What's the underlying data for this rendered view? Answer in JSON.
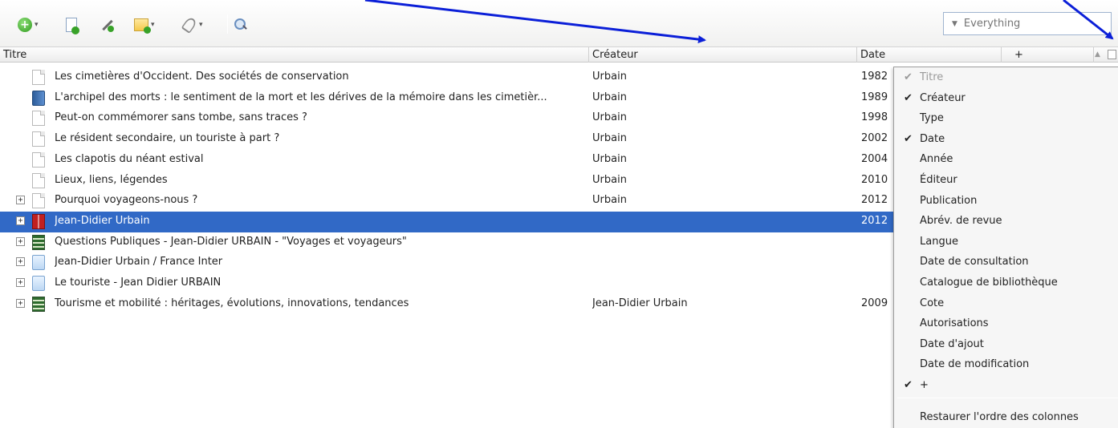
{
  "toolbar": {
    "buttons": [
      {
        "icon": "new-item-icon",
        "has_dropdown": true
      },
      {
        "icon": "add-by-identifier-icon",
        "has_dropdown": false
      },
      {
        "icon": "new-note-wand-icon",
        "has_dropdown": false
      },
      {
        "icon": "new-note-icon",
        "has_dropdown": true
      },
      {
        "icon": "attachment-paperclip-icon",
        "has_dropdown": true
      },
      {
        "icon": "advanced-search-icon",
        "has_dropdown": false
      }
    ],
    "caret": "▾",
    "search": {
      "mode_caret": "▼",
      "placeholder": "Everything"
    }
  },
  "columns": {
    "title": "Titre",
    "creator": "Créateur",
    "date": "Date",
    "extra": "+",
    "sort_indicator": "▲"
  },
  "items": [
    {
      "title": "Les cimetières d'Occident. Des sociétés de conservation",
      "creator": "Urbain",
      "date": "1982",
      "icon": "journal-article-icon",
      "expandable": false,
      "selected": false
    },
    {
      "title": "L'archipel des morts : le sentiment de la mort et les dérives de la mémoire dans les cimetièr...",
      "creator": "Urbain",
      "date": "1989",
      "icon": "book-icon",
      "expandable": false,
      "selected": false
    },
    {
      "title": "Peut-on commémorer sans tombe, sans traces ?",
      "creator": "Urbain",
      "date": "1998",
      "icon": "journal-article-icon",
      "expandable": false,
      "selected": false
    },
    {
      "title": "Le résident secondaire, un touriste à part ?",
      "creator": "Urbain",
      "date": "2002",
      "icon": "journal-article-icon",
      "expandable": false,
      "selected": false
    },
    {
      "title": "Les clapotis du néant estival",
      "creator": "Urbain",
      "date": "2004",
      "icon": "journal-article-icon",
      "expandable": false,
      "selected": false
    },
    {
      "title": "Lieux, liens, légendes",
      "creator": "Urbain",
      "date": "2010",
      "icon": "journal-article-icon",
      "expandable": false,
      "selected": false
    },
    {
      "title": "Pourquoi voyageons-nous ?",
      "creator": "Urbain",
      "date": "2012",
      "icon": "journal-article-icon",
      "expandable": true,
      "selected": false
    },
    {
      "title": "Jean-Didier Urbain",
      "creator": "",
      "date": "2012",
      "icon": "encyclopedia-icon",
      "expandable": true,
      "selected": true
    },
    {
      "title": "Questions Publiques - Jean-Didier URBAIN - \"Voyages et voyageurs\"",
      "creator": "",
      "date": "",
      "icon": "video-film-icon",
      "expandable": true,
      "selected": false
    },
    {
      "title": "Jean-Didier Urbain / France Inter",
      "creator": "",
      "date": "",
      "icon": "web-page-icon",
      "expandable": true,
      "selected": false
    },
    {
      "title": "Le touriste - Jean Didier URBAIN",
      "creator": "",
      "date": "",
      "icon": "web-page-icon",
      "expandable": true,
      "selected": false
    },
    {
      "title": "Tourisme et mobilité : héritages, évolutions, innovations, tendances",
      "creator": "Jean-Didier Urbain",
      "date": "2009",
      "icon": "video-film-icon",
      "expandable": true,
      "selected": false
    }
  ],
  "expand_glyph": "+",
  "column_menu": {
    "check_glyph": "✔",
    "items": [
      {
        "label": "Titre",
        "checked": true,
        "disabled": true
      },
      {
        "label": "Créateur",
        "checked": true,
        "disabled": false
      },
      {
        "label": "Type",
        "checked": false,
        "disabled": false
      },
      {
        "label": "Date",
        "checked": true,
        "disabled": false
      },
      {
        "label": "Année",
        "checked": false,
        "disabled": false
      },
      {
        "label": "Éditeur",
        "checked": false,
        "disabled": false
      },
      {
        "label": "Publication",
        "checked": false,
        "disabled": false
      },
      {
        "label": "Abrév. de revue",
        "checked": false,
        "disabled": false
      },
      {
        "label": "Langue",
        "checked": false,
        "disabled": false
      },
      {
        "label": "Date de consultation",
        "checked": false,
        "disabled": false
      },
      {
        "label": "Catalogue de bibliothèque",
        "checked": false,
        "disabled": false
      },
      {
        "label": "Cote",
        "checked": false,
        "disabled": false
      },
      {
        "label": "Autorisations",
        "checked": false,
        "disabled": false
      },
      {
        "label": "Date d'ajout",
        "checked": false,
        "disabled": false
      },
      {
        "label": "Date de modification",
        "checked": false,
        "disabled": false
      },
      {
        "label": "+",
        "checked": true,
        "disabled": false
      }
    ],
    "restore_label": "Restaurer l'ordre des colonnes"
  },
  "colors": {
    "selection": "#3169c6",
    "annotation_arrow": "#0b1fd8"
  }
}
